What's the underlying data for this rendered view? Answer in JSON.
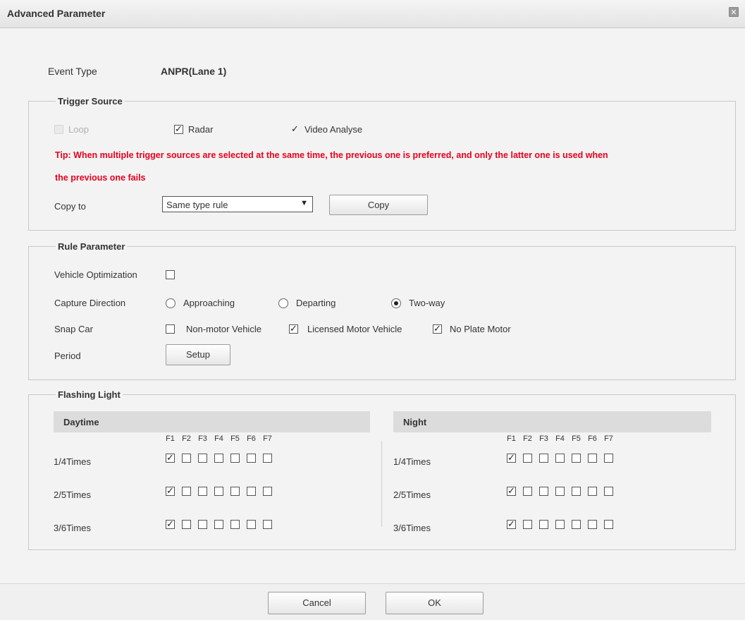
{
  "window": {
    "title": "Advanced Parameter"
  },
  "event_type": {
    "label": "Event Type",
    "value": "ANPR(Lane 1)"
  },
  "trigger_source": {
    "legend": "Trigger Source",
    "options": [
      {
        "label": "Loop",
        "checked": false,
        "disabled": true
      },
      {
        "label": "Radar",
        "checked": true,
        "disabled": false
      },
      {
        "label": "Video Analyse",
        "checked": true,
        "disabled": false
      }
    ],
    "tip_line1": "Tip: When multiple trigger sources are selected at the same time, the previous one is preferred, and only the latter one is used when",
    "tip_line2": "the previous one fails",
    "copy_to_label": "Copy to",
    "copy_to_value": "Same type rule",
    "copy_button": "Copy"
  },
  "rule_parameter": {
    "legend": "Rule Parameter",
    "vehicle_optimization_label": "Vehicle Optimization",
    "vehicle_optimization_checked": false,
    "capture_direction_label": "Capture Direction",
    "capture_direction_options": [
      "Approaching",
      "Departing",
      "Two-way"
    ],
    "capture_direction_selected": "Two-way",
    "snap_car_label": "Snap Car",
    "snap_car_options": [
      {
        "label": "Non-motor Vehicle",
        "checked": false
      },
      {
        "label": "Licensed Motor Vehicle",
        "checked": true
      },
      {
        "label": "No Plate Motor",
        "checked": true
      }
    ],
    "period_label": "Period",
    "setup_button": "Setup"
  },
  "flashing_light": {
    "legend": "Flashing Light",
    "flash_labels": [
      "F1",
      "F2",
      "F3",
      "F4",
      "F5",
      "F6",
      "F7"
    ],
    "daytime": {
      "title": "Daytime",
      "rows": [
        {
          "label": "1/4Times",
          "checked": [
            true,
            false,
            false,
            false,
            false,
            false,
            false
          ]
        },
        {
          "label": "2/5Times",
          "checked": [
            true,
            false,
            false,
            false,
            false,
            false,
            false
          ]
        },
        {
          "label": "3/6Times",
          "checked": [
            true,
            false,
            false,
            false,
            false,
            false,
            false
          ]
        }
      ]
    },
    "night": {
      "title": "Night",
      "rows": [
        {
          "label": "1/4Times",
          "checked": [
            true,
            false,
            false,
            false,
            false,
            false,
            false
          ]
        },
        {
          "label": "2/5Times",
          "checked": [
            true,
            false,
            false,
            false,
            false,
            false,
            false
          ]
        },
        {
          "label": "3/6Times",
          "checked": [
            true,
            false,
            false,
            false,
            false,
            false,
            false
          ]
        }
      ]
    }
  },
  "footer": {
    "cancel_button": "Cancel",
    "ok_button": "OK"
  },
  "icons": {
    "close": "close-icon",
    "check": "check-icon",
    "dropdown": "chevron-down-icon"
  }
}
